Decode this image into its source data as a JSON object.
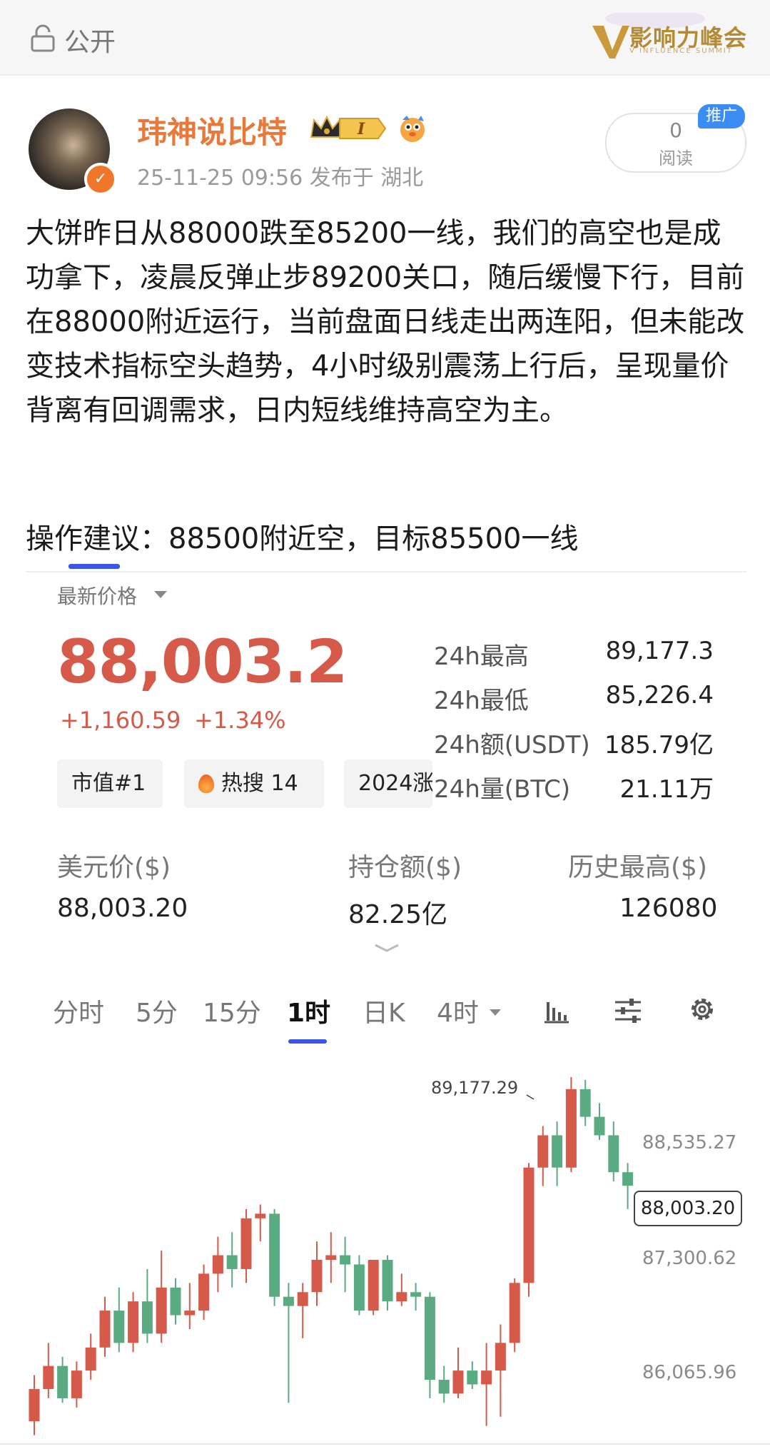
{
  "topbar": {
    "visibility_label": "公开",
    "summit_logo_text": "影响力峰会",
    "summit_logo_sub": "V INFLUENCE SUMMIT"
  },
  "author": {
    "name": "玮神说比特",
    "level_badge": "I",
    "meta": "25-11-25 09:56  发布于 湖北",
    "read_count": "0",
    "read_label": "阅读",
    "promo_tag": "推广"
  },
  "post": {
    "body": "大饼昨日从88000跌至85200一线，我们的高空也是成功拿下，凌晨反弹止步89200关口，随后缓慢下行，目前在88000附近运行，当前盘面日线走出两连阳，但未能改变技术指标空头趋势，4小时级别震荡上行后，呈现量价背离有回调需求，日内短线维持高空为主。",
    "advice": "操作建议：88500附近空，目标85500一线"
  },
  "ticker": {
    "latest_label": "最新价格",
    "price": "88,003.2",
    "change_abs": "+1,160.59",
    "change_pct": "+1.34%",
    "stats": [
      {
        "label": "24h最高",
        "value": "89,177.3"
      },
      {
        "label": "24h最低",
        "value": "85,226.4"
      },
      {
        "label": "24h额(USDT)",
        "value": "185.79亿"
      },
      {
        "label": "24h量(BTC)",
        "value": "21.11万"
      }
    ],
    "chips": {
      "rank": "市值#1",
      "hot": "热搜 14",
      "year": "2024涨"
    },
    "info": [
      {
        "label": "美元价($)",
        "value": "88,003.20"
      },
      {
        "label": "持仓额($)",
        "value": "82.25亿"
      },
      {
        "label": "历史最高($)",
        "value": "126080"
      }
    ],
    "intervals": [
      "分时",
      "5分",
      "15分",
      "1时",
      "日K",
      "4时"
    ],
    "active_interval": "1时"
  },
  "colors": {
    "up": "#d55a4a",
    "down": "#5aab82",
    "accent": "#3b55e6",
    "author": "#e8793a"
  },
  "chart_data": {
    "type": "candlestick",
    "y_axis_labels": [
      "88,535.27",
      "87,300.62",
      "86,065.96"
    ],
    "last_price_tag": "88,003.20",
    "peak_label": "89,177.29",
    "ylim": [
      85150,
      89250
    ],
    "candles": [
      {
        "o": 85450,
        "h": 85950,
        "l": 85300,
        "c": 85800
      },
      {
        "o": 85800,
        "h": 86300,
        "l": 85700,
        "c": 86050
      },
      {
        "o": 86050,
        "h": 86150,
        "l": 85650,
        "c": 85700
      },
      {
        "o": 85700,
        "h": 86100,
        "l": 85600,
        "c": 86000
      },
      {
        "o": 86000,
        "h": 86400,
        "l": 85900,
        "c": 86250
      },
      {
        "o": 86250,
        "h": 86800,
        "l": 86150,
        "c": 86650
      },
      {
        "o": 86650,
        "h": 86900,
        "l": 86200,
        "c": 86300
      },
      {
        "o": 86300,
        "h": 86850,
        "l": 86200,
        "c": 86750
      },
      {
        "o": 86750,
        "h": 87100,
        "l": 86300,
        "c": 86400
      },
      {
        "o": 86400,
        "h": 87300,
        "l": 86300,
        "c": 86900
      },
      {
        "o": 86900,
        "h": 87000,
        "l": 86500,
        "c": 86600
      },
      {
        "o": 86600,
        "h": 86950,
        "l": 86450,
        "c": 86650
      },
      {
        "o": 86650,
        "h": 87150,
        "l": 86550,
        "c": 87050
      },
      {
        "o": 87050,
        "h": 87450,
        "l": 86850,
        "c": 87250
      },
      {
        "o": 87250,
        "h": 87500,
        "l": 86900,
        "c": 87100
      },
      {
        "o": 87100,
        "h": 87750,
        "l": 86950,
        "c": 87650
      },
      {
        "o": 87650,
        "h": 87800,
        "l": 87400,
        "c": 87700
      },
      {
        "o": 87700,
        "h": 87750,
        "l": 86700,
        "c": 86800
      },
      {
        "o": 86800,
        "h": 86950,
        "l": 85650,
        "c": 86700
      },
      {
        "o": 86700,
        "h": 86950,
        "l": 86350,
        "c": 86850
      },
      {
        "o": 86850,
        "h": 87400,
        "l": 86700,
        "c": 87200
      },
      {
        "o": 87200,
        "h": 87500,
        "l": 86950,
        "c": 87250
      },
      {
        "o": 87250,
        "h": 87450,
        "l": 86850,
        "c": 87150
      },
      {
        "o": 87150,
        "h": 87250,
        "l": 86600,
        "c": 86650
      },
      {
        "o": 86650,
        "h": 87200,
        "l": 86600,
        "c": 87200
      },
      {
        "o": 87200,
        "h": 87250,
        "l": 86650,
        "c": 86750
      },
      {
        "o": 86750,
        "h": 87050,
        "l": 86700,
        "c": 86850
      },
      {
        "o": 86850,
        "h": 86950,
        "l": 86650,
        "c": 86800
      },
      {
        "o": 86800,
        "h": 86850,
        "l": 85700,
        "c": 85900
      },
      {
        "o": 85900,
        "h": 86050,
        "l": 85650,
        "c": 85750
      },
      {
        "o": 85750,
        "h": 86250,
        "l": 85700,
        "c": 86000
      },
      {
        "o": 86000,
        "h": 86100,
        "l": 85800,
        "c": 85850
      },
      {
        "o": 85850,
        "h": 86300,
        "l": 85400,
        "c": 86000
      },
      {
        "o": 86000,
        "h": 86500,
        "l": 85500,
        "c": 86300
      },
      {
        "o": 86300,
        "h": 87000,
        "l": 86200,
        "c": 86950
      },
      {
        "o": 86950,
        "h": 88250,
        "l": 86800,
        "c": 88200
      },
      {
        "o": 88200,
        "h": 88650,
        "l": 88000,
        "c": 88550
      },
      {
        "o": 88550,
        "h": 88700,
        "l": 88000,
        "c": 88200
      },
      {
        "o": 88200,
        "h": 89180,
        "l": 88150,
        "c": 89050
      },
      {
        "o": 89050,
        "h": 89150,
        "l": 88650,
        "c": 88750
      },
      {
        "o": 88750,
        "h": 88900,
        "l": 88500,
        "c": 88550
      },
      {
        "o": 88550,
        "h": 88700,
        "l": 88050,
        "c": 88150
      },
      {
        "o": 88150,
        "h": 88250,
        "l": 87750,
        "c": 88003
      }
    ]
  }
}
